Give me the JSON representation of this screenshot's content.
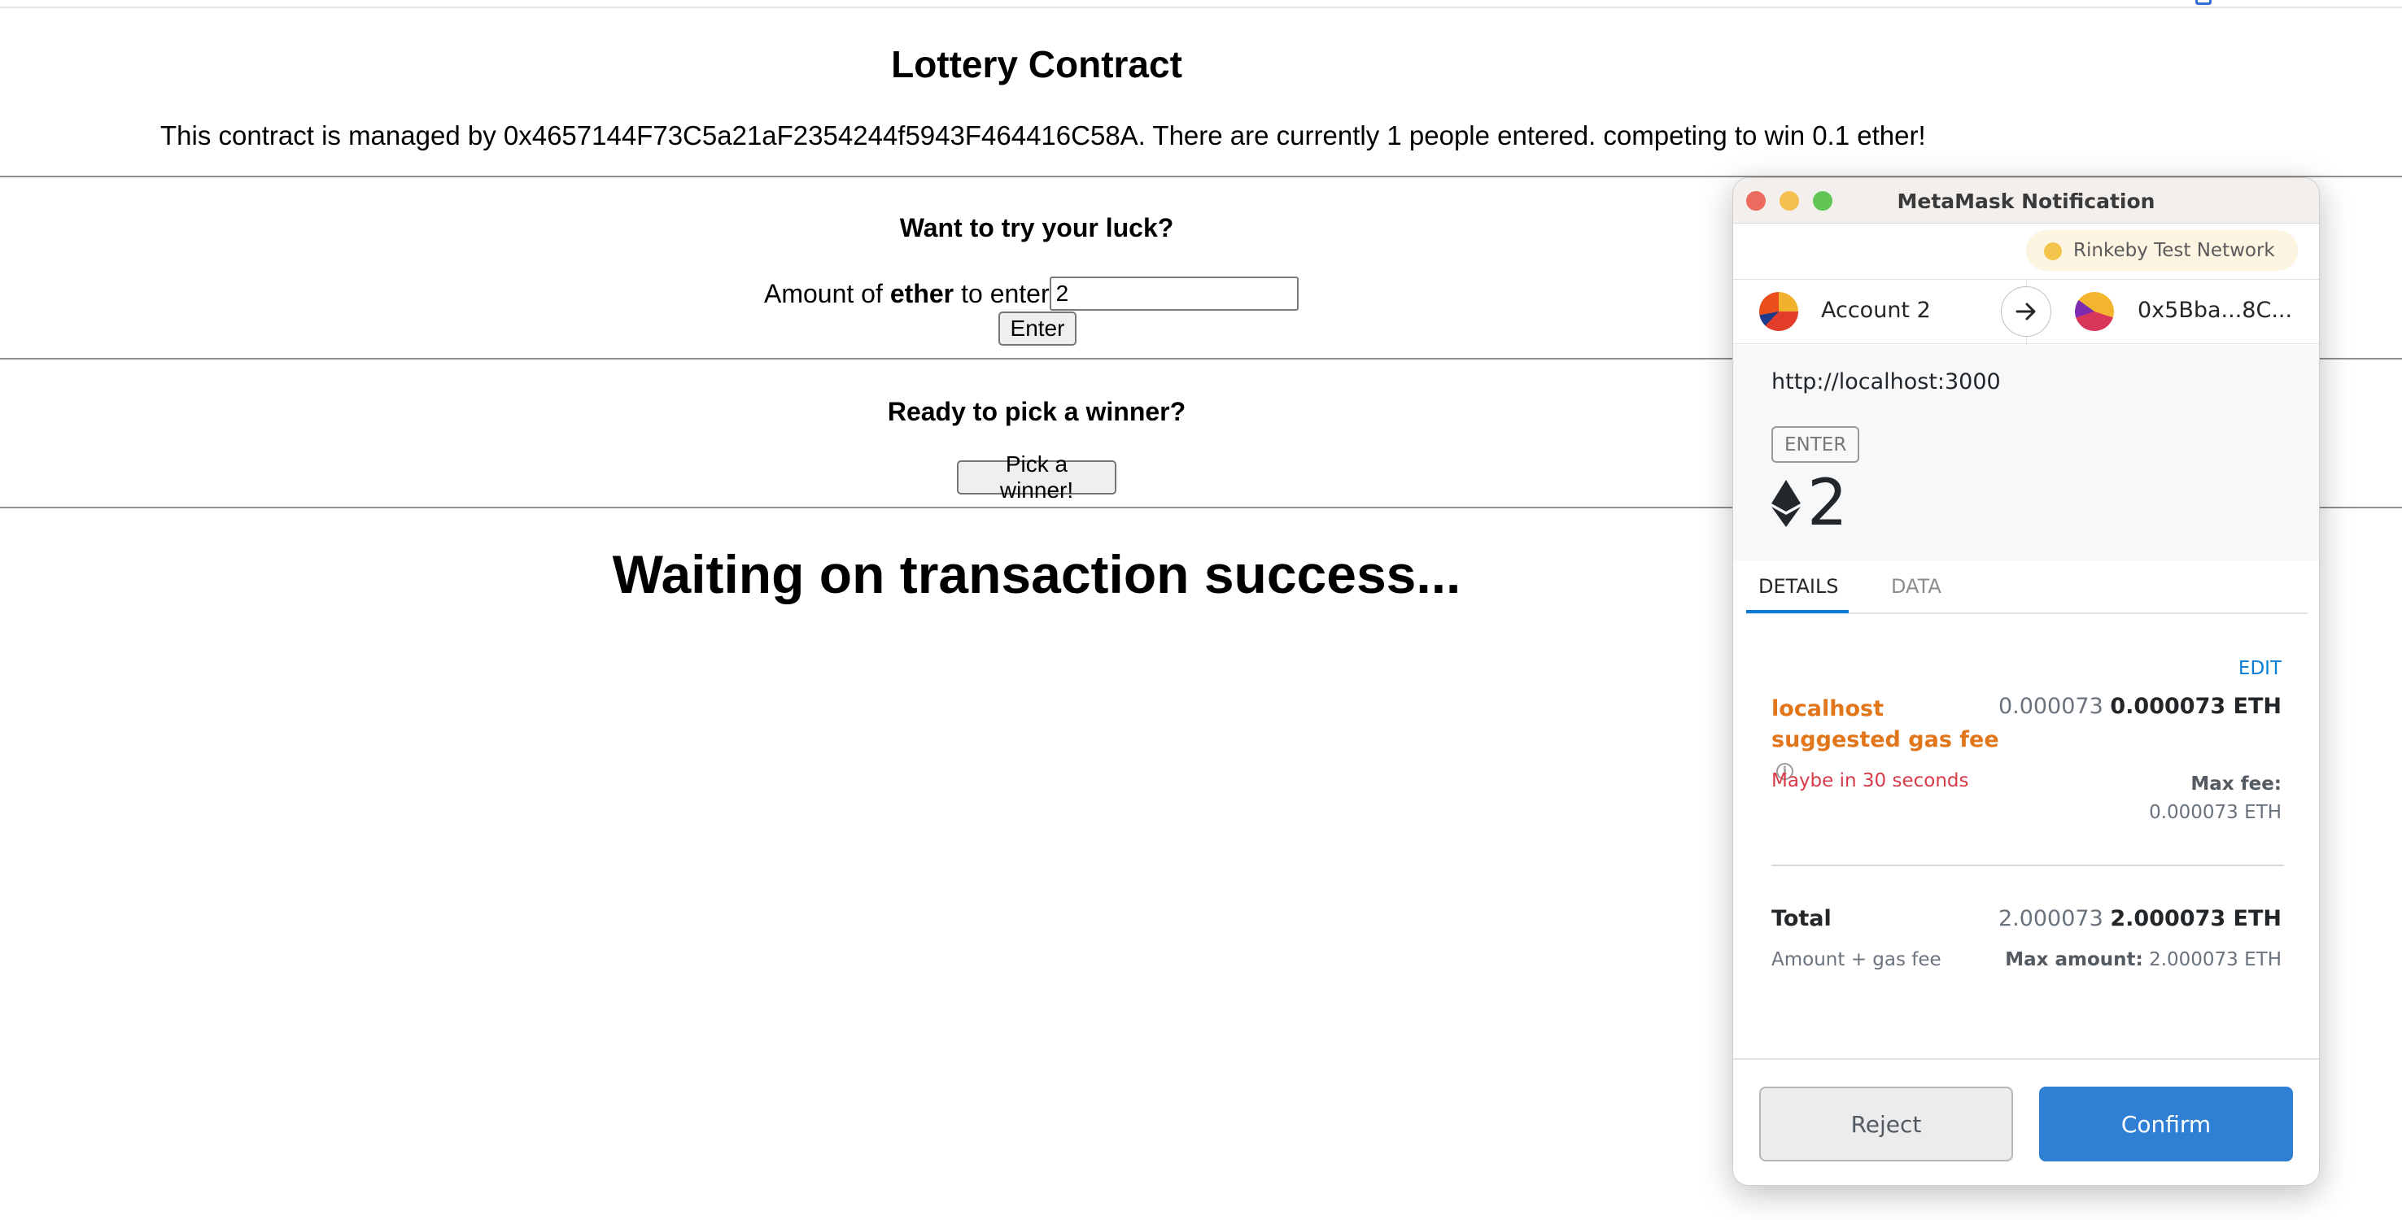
{
  "page": {
    "title": "Lottery Contract",
    "intro": "This contract is managed by 0x4657144F73C5a21aF2354244f5943F464416C58A. There are currently 1 people entered. competing to win 0.1 ether!",
    "enter_section": {
      "heading": "Want to try your luck?",
      "label_prefix": "Amount of",
      "label_bold": "ether",
      "label_suffix": "to enter",
      "input_value": "2",
      "button_label": "Enter"
    },
    "winner_section": {
      "heading": "Ready to pick a winner?",
      "button_label": "Pick a winner!"
    },
    "status_message": "Waiting on transaction success..."
  },
  "metamask": {
    "window_title": "MetaMask Notification",
    "network": "Rinkeby Test Network",
    "from_account": "Account 2",
    "to_address": "0x5Bba...8C...",
    "origin": "http://localhost:3000",
    "method": "ENTER",
    "amount": "2",
    "tabs": [
      "DETAILS",
      "DATA"
    ],
    "active_tab": "DETAILS",
    "edit_label": "EDIT",
    "gas_fee_label": "localhost suggested gas fee",
    "gas_fee_muted": "0.000073",
    "gas_fee_strong": "0.000073 ETH",
    "timing": "Maybe in 30 seconds",
    "max_fee_label": "Max fee:",
    "max_fee_value": "0.000073 ETH",
    "total_label": "Total",
    "total_muted": "2.000073",
    "total_strong": "2.000073 ETH",
    "total_sub": "Amount + gas fee",
    "max_amount_label": "Max amount:",
    "max_amount_value": "2.000073 ETH",
    "reject_label": "Reject",
    "confirm_label": "Confirm"
  },
  "icons": {
    "arrow": "arrow-right-icon",
    "ethereum": "ethereum-icon",
    "info": "info-icon"
  },
  "colors": {
    "confirm_blue": "#2f80d5",
    "gas_orange": "#e2761b",
    "timing_red": "#d73a49",
    "link_blue": "#037dd6"
  }
}
